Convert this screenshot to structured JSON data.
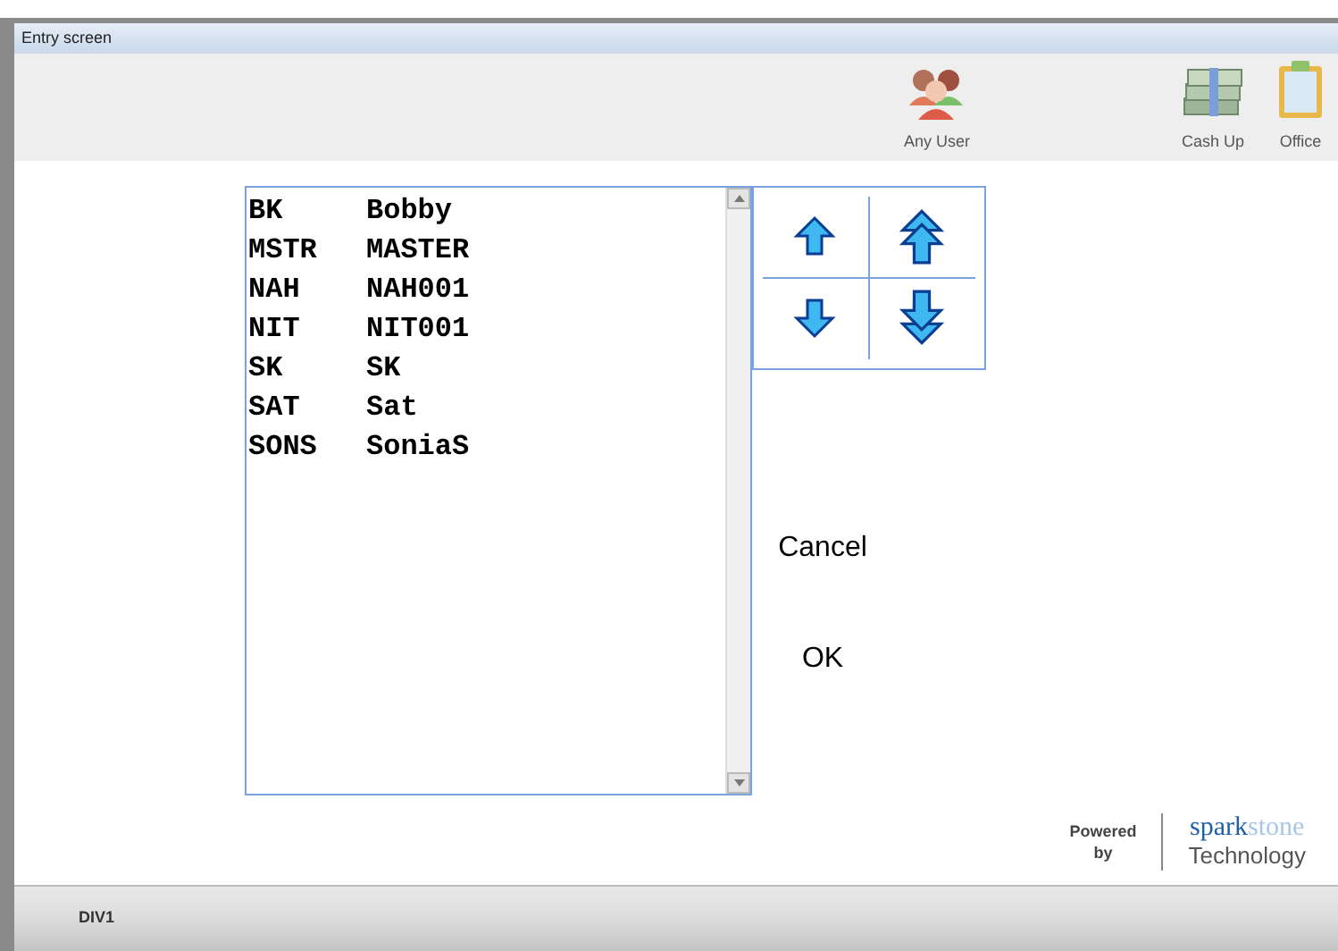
{
  "window": {
    "title": "Entry screen"
  },
  "toolbar": [
    {
      "label": "Any User",
      "kind": "users"
    },
    {
      "label": "Cash Up",
      "kind": "cash"
    },
    {
      "label": "Office",
      "kind": "clipboard"
    }
  ],
  "list": [
    {
      "code": "BK",
      "name": "Bobby"
    },
    {
      "code": "MSTR",
      "name": "MASTER"
    },
    {
      "code": "NAH",
      "name": "NAH001"
    },
    {
      "code": "NIT",
      "name": "NIT001"
    },
    {
      "code": "SK",
      "name": "SK"
    },
    {
      "code": "SAT",
      "name": "Sat"
    },
    {
      "code": "SONS",
      "name": "SoniaS"
    }
  ],
  "nav_buttons": [
    {
      "kind": "up"
    },
    {
      "kind": "top"
    },
    {
      "kind": "down"
    },
    {
      "kind": "bottom"
    }
  ],
  "actions": [
    "Cancel",
    "OK"
  ],
  "branding": {
    "powered": "Powered",
    "by": "by",
    "logo_part_1": "spark",
    "logo_part_2": "stone",
    "tagline": "Technology"
  },
  "status_bar": {
    "text": "DIV1"
  }
}
